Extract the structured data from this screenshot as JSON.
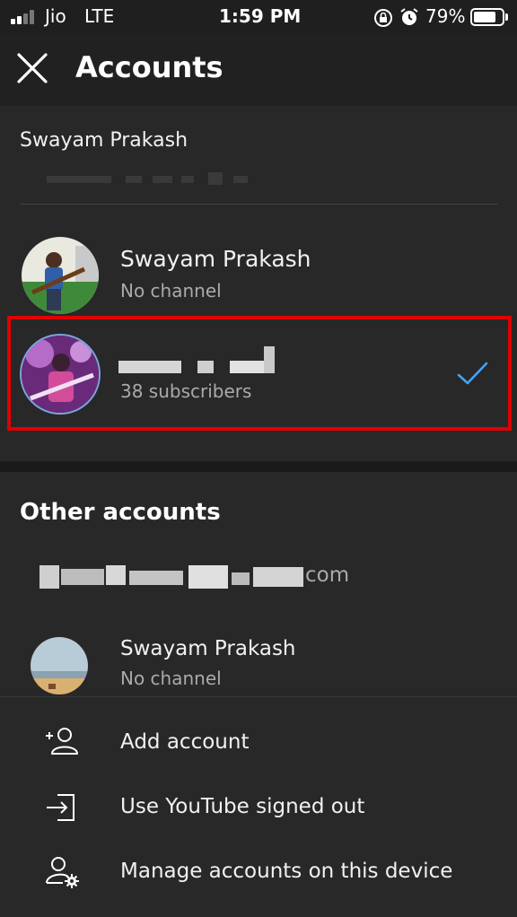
{
  "status_bar": {
    "carrier": "Jio",
    "network": "LTE",
    "time": "1:59 PM",
    "battery": "79%",
    "battery_level": 0.79,
    "icons": [
      "signal-icon",
      "orientation-lock-icon",
      "alarm-icon",
      "battery-icon"
    ]
  },
  "app_bar": {
    "title": "Accounts",
    "close_icon": "close-icon"
  },
  "current_google_account": {
    "name": "Swayam Prakash"
  },
  "channels": [
    {
      "name": "Swayam Prakash",
      "subtitle": "No channel",
      "selected": false
    },
    {
      "name": "",
      "subtitle": "38 subscribers",
      "selected": true
    }
  ],
  "other_accounts": {
    "title": "Other accounts",
    "email_suffix": "com",
    "accounts": [
      {
        "name": "Swayam Prakash",
        "subtitle": "No channel"
      }
    ]
  },
  "menu": [
    {
      "label": "Add account",
      "icon": "add-person-icon"
    },
    {
      "label": "Use YouTube signed out",
      "icon": "sign-out-icon"
    },
    {
      "label": "Manage accounts on this device",
      "icon": "manage-accounts-icon"
    }
  ],
  "colors": {
    "background": "#282828",
    "app_bar": "#212121",
    "highlight": "#e00000",
    "check": "#3ea6ff",
    "secondary_text": "#aaaaaa"
  }
}
